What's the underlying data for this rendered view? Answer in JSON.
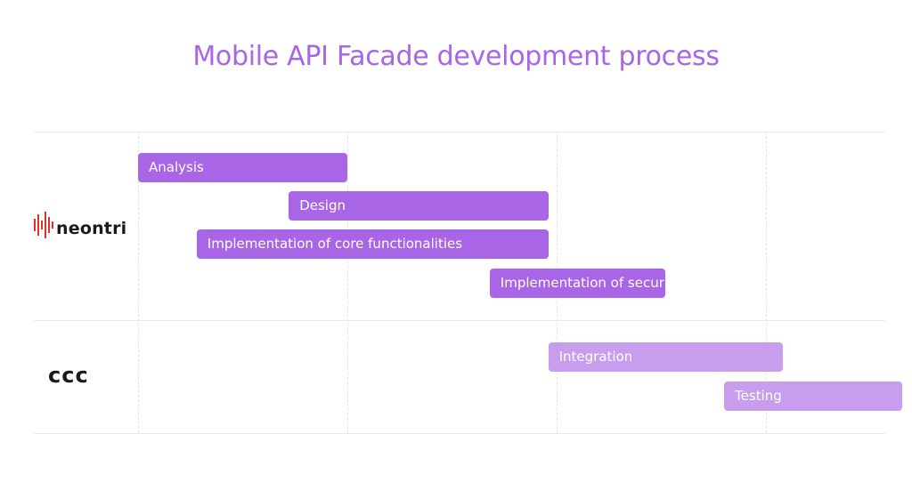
{
  "chart_data": {
    "type": "gantt",
    "title": "Mobile API Facade development process",
    "groups": [
      {
        "name": "neontri",
        "color": "#a866e6",
        "tasks": [
          {
            "label": "Analysis",
            "start": 0,
            "end": 1.0
          },
          {
            "label": "Design",
            "start": 0.72,
            "end": 1.96
          },
          {
            "label": "Implementation of core functionalities",
            "start": 0.28,
            "end": 1.96
          },
          {
            "label": "Implementation of security features",
            "start": 1.68,
            "end": 2.52
          }
        ]
      },
      {
        "name": "ccc",
        "color": "#c99ded",
        "tasks": [
          {
            "label": "Integration",
            "start": 1.96,
            "end": 3.08
          },
          {
            "label": "Testing",
            "start": 2.8,
            "end": 3.65
          }
        ]
      }
    ],
    "grid": true
  }
}
